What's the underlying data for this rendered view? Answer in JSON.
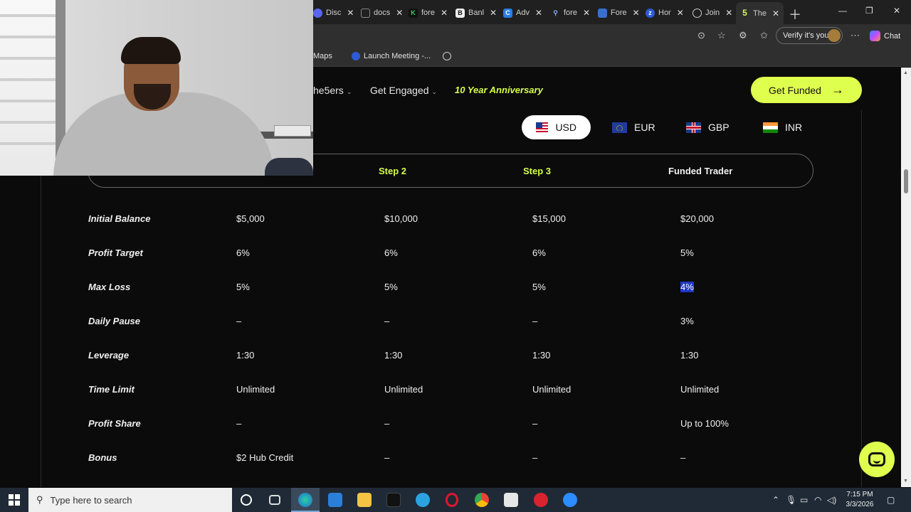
{
  "browser": {
    "tabs": [
      {
        "label": "Disc",
        "color": "#5865f2"
      },
      {
        "label": "docs",
        "color": "#7a7a7a"
      },
      {
        "label": "fore",
        "color": "#2bd26b"
      },
      {
        "label": "Banl",
        "color": "#ffffff"
      },
      {
        "label": "Adv",
        "color": "#2a7de1"
      },
      {
        "label": "fore",
        "color": "#8ab4f8"
      },
      {
        "label": "Fore",
        "color": "#3b6fcf"
      },
      {
        "label": "Hor",
        "color": "#2d5bd7"
      },
      {
        "label": "Join",
        "color": "#cccccc"
      },
      {
        "label": "The",
        "color": "#d6ff45"
      }
    ],
    "verify_label": "Verify it's you",
    "chat_label": "Chat",
    "bookmarks": [
      {
        "label": "Maps"
      },
      {
        "label": "Launch Meeting -..."
      }
    ]
  },
  "site_nav": {
    "item1": "he5ers",
    "item2": "Get Engaged",
    "anniversary": "10 Year Anniversary",
    "cta": "Get Funded",
    "accent_color": "#dfff4f"
  },
  "currencies": [
    {
      "code": "USD",
      "selected": true
    },
    {
      "code": "EUR",
      "selected": false
    },
    {
      "code": "GBP",
      "selected": false
    },
    {
      "code": "INR",
      "selected": false
    }
  ],
  "steps": [
    "Step 2",
    "Step 3",
    "Funded Trader"
  ],
  "table": {
    "rows": [
      {
        "label": "Initial Balance",
        "values": [
          "$5,000",
          "$10,000",
          "$15,000",
          "$20,000"
        ]
      },
      {
        "label": "Profit Target",
        "values": [
          "6%",
          "6%",
          "6%",
          "5%"
        ]
      },
      {
        "label": "Max Loss",
        "values": [
          "5%",
          "5%",
          "5%",
          "4%"
        ]
      },
      {
        "label": "Daily Pause",
        "values": [
          "–",
          "–",
          "–",
          "3%"
        ]
      },
      {
        "label": "Leverage",
        "values": [
          "1:30",
          "1:30",
          "1:30",
          "1:30"
        ]
      },
      {
        "label": "Time Limit",
        "values": [
          "Unlimited",
          "Unlimited",
          "Unlimited",
          "Unlimited"
        ]
      },
      {
        "label": "Profit Share",
        "values": [
          "–",
          "–",
          "–",
          "Up to 100%"
        ]
      },
      {
        "label": "Bonus",
        "values": [
          "$2 Hub Credit",
          "–",
          "–",
          "–"
        ]
      }
    ]
  },
  "taskbar": {
    "search_placeholder": "Type here to search",
    "time": "7:15 PM",
    "date": "3/3/2026"
  }
}
